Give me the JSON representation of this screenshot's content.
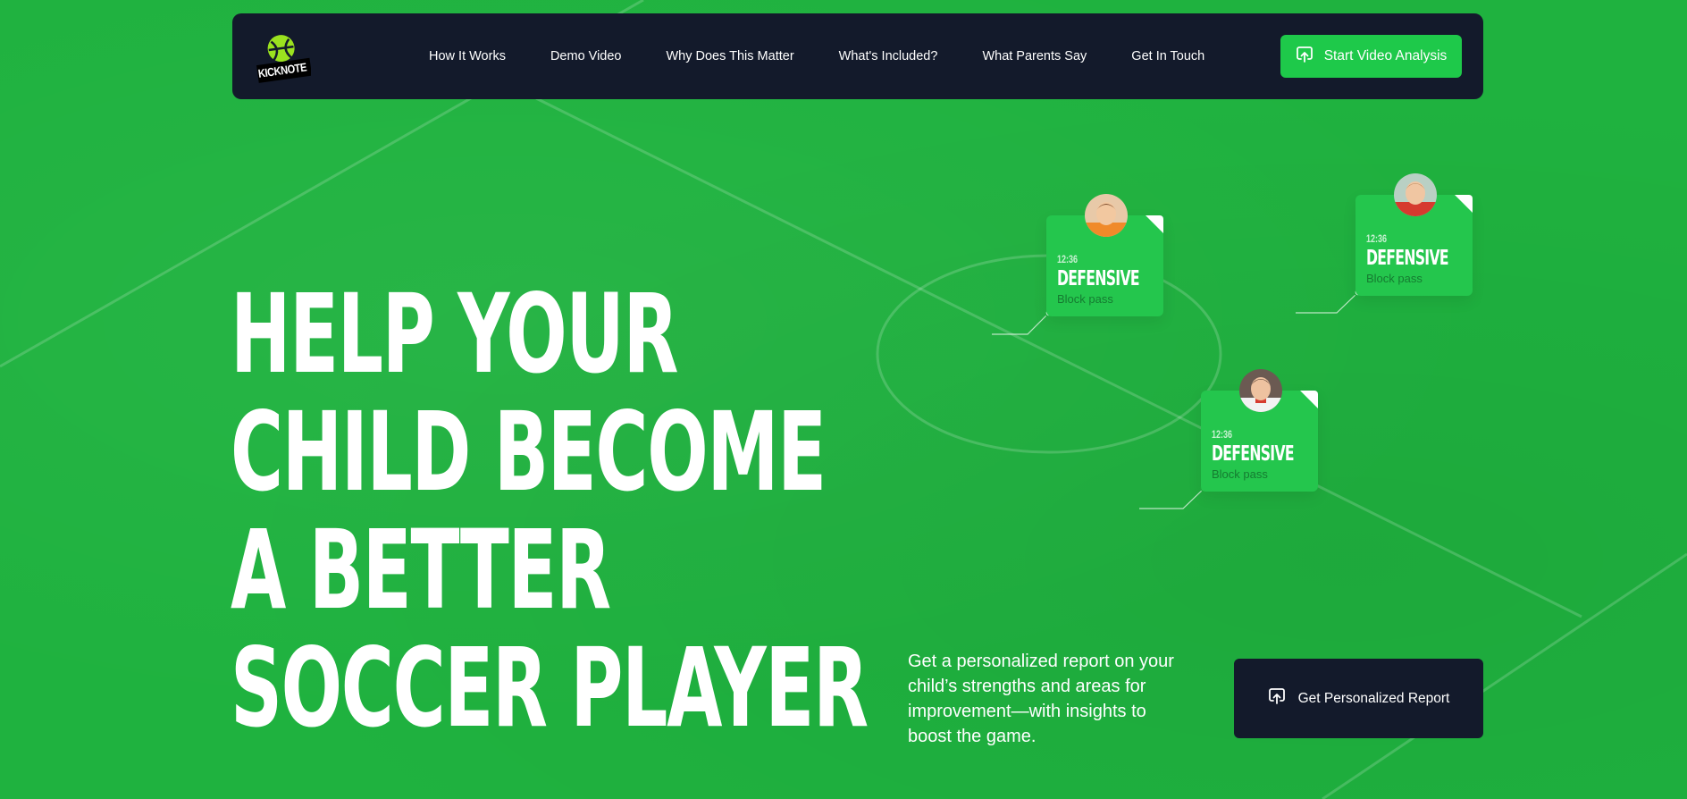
{
  "brand": {
    "logo_text": "KICKNOTE",
    "logo_icon": "soccer-ball-icon"
  },
  "nav": {
    "links": [
      "How It Works",
      "Demo Video",
      "Why Does This Matter",
      "What's Included?",
      "What Parents Say",
      "Get In Touch"
    ],
    "cta_label": "Start Video Analysis",
    "cta_icon": "upload-icon"
  },
  "hero": {
    "headline_lines": [
      "HELP YOUR",
      "CHILD BECOME",
      "A BETTER",
      "SOCCER PLAYER"
    ],
    "subtext": "Get a personalized report on your child’s strengths and areas for improvement—with insights to boost the game.",
    "report_button_label": "Get Personalized Report",
    "report_button_icon": "upload-icon"
  },
  "event_cards": [
    {
      "time": "12:36",
      "type": "DEFENSIVE",
      "desc": "Block pass",
      "avatar": "player-avatar-orange-shirt"
    },
    {
      "time": "12:36",
      "type": "DEFENSIVE",
      "desc": "Block pass",
      "avatar": "player-avatar-red-shirt"
    },
    {
      "time": "12:36",
      "type": "DEFENSIVE",
      "desc": "Block pass",
      "avatar": "player-avatar-white-shirt"
    }
  ],
  "colors": {
    "background": "#1fb23f",
    "navbar": "#131a2b",
    "accent": "#1ec94a",
    "card": "#24c64d",
    "text": "#ffffff"
  }
}
